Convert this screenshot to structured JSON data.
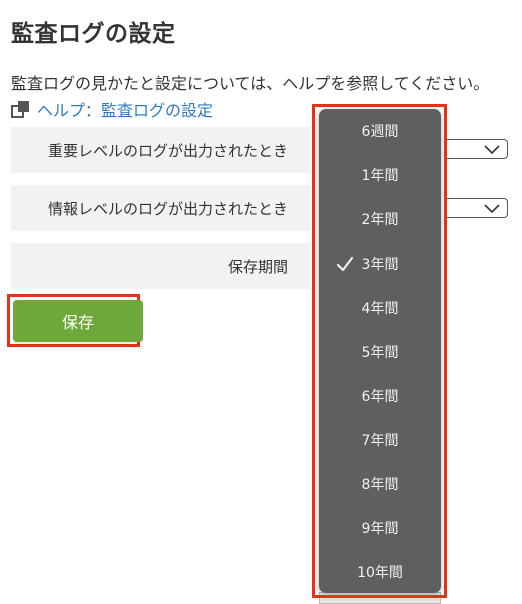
{
  "page": {
    "title": "監査ログの設定",
    "intro": "監査ログの見かたと設定については、ヘルプを参照してください。",
    "help_link": "ヘルプ：監査ログの設定"
  },
  "settings": {
    "rows": [
      {
        "label": "重要レベルのログが出力されたとき"
      },
      {
        "label": "情報レベルのログが出力されたとき"
      },
      {
        "label": "保存期間"
      }
    ],
    "save_label": "保存"
  },
  "retention_dropdown": {
    "options": [
      "6週間",
      "1年間",
      "2年間",
      "3年間",
      "4年間",
      "5年間",
      "6年間",
      "7年間",
      "8年間",
      "9年間",
      "10年間"
    ],
    "selected": "3年間"
  },
  "colors": {
    "accent_green": "#6fa83a",
    "link_blue": "#2e7bc4",
    "highlight_red": "#e53119",
    "menu_bg": "#5f5f5f"
  },
  "icons": {
    "help": "external-window-icon",
    "select": "chevron-down-icon",
    "selected": "checkmark-icon"
  }
}
